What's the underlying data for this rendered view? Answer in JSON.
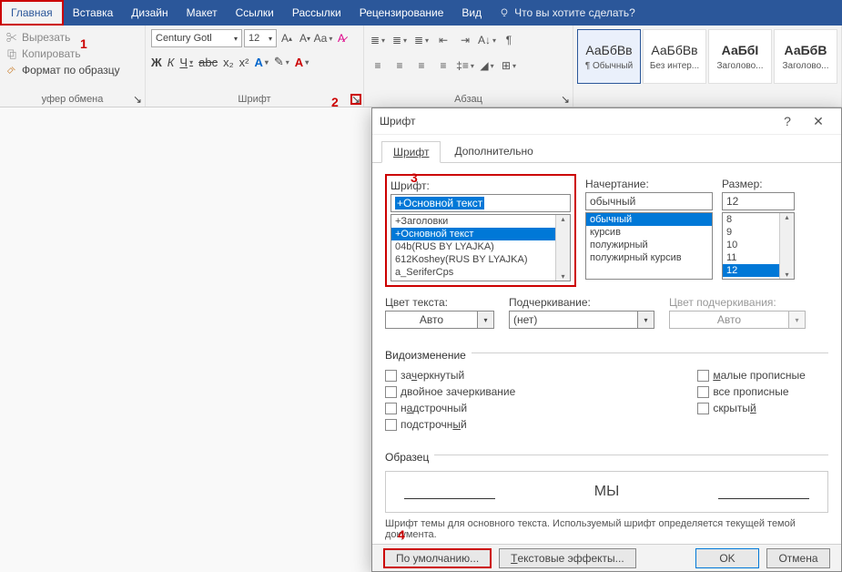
{
  "menubar": {
    "tabs": [
      "Главная",
      "Вставка",
      "Дизайн",
      "Макет",
      "Ссылки",
      "Рассылки",
      "Рецензирование",
      "Вид"
    ],
    "tell_me": "Что вы хотите сделать?"
  },
  "annotations": {
    "a1": "1",
    "a2": "2",
    "a3": "3",
    "a4": "4"
  },
  "ribbon": {
    "clipboard": {
      "cut": "Вырезать",
      "copy": "Копировать",
      "format_painter": "Формат по образцу",
      "group": "уфер обмена"
    },
    "font": {
      "name": "Century Gotl",
      "size": "12",
      "group": "Шрифт",
      "bold": "Ж",
      "italic": "К",
      "underline": "Ч",
      "strike": "abc",
      "sub": "x₂",
      "sup": "x²"
    },
    "paragraph": {
      "group": "Абзац"
    },
    "styles": {
      "preview": "АаБбВв",
      "preview_bold": "АаБбI",
      "preview_bold2": "АаБбВ",
      "s1": "¶ Обычный",
      "s2": "Без интер...",
      "s3": "Заголово...",
      "s4": "Заголово..."
    }
  },
  "dialog": {
    "title": "Шрифт",
    "tabs": {
      "font": "Шрифт",
      "advanced": "Дополнительно"
    },
    "font_label": "Шрифт:",
    "font_value": "+Основной текст",
    "font_list": [
      "+Заголовки",
      "+Основной текст",
      "04b(RUS BY LYAJKA)",
      "612Koshey(RUS BY LYAJKA)",
      "a_SeriferCps"
    ],
    "style_label": "Начертание:",
    "style_value": "обычный",
    "style_list": [
      "обычный",
      "курсив",
      "полужирный",
      "полужирный курсив"
    ],
    "size_label": "Размер:",
    "size_value": "12",
    "size_list": [
      "8",
      "9",
      "10",
      "11",
      "12"
    ],
    "color_label": "Цвет текста:",
    "color_value": "Авто",
    "underline_label": "Подчеркивание:",
    "underline_value": "(нет)",
    "ucolor_label": "Цвет подчеркивания:",
    "ucolor_value": "Авто",
    "effects_label": "Видоизменение",
    "effects": {
      "strike": "зачеркнутый",
      "dstrike": "двойное зачеркивание",
      "superscript": "надстрочный",
      "subscript": "подстрочный",
      "smallcaps": "малые прописные",
      "allcaps": "все прописные",
      "hidden": "скрытый"
    },
    "sample_label": "Образец",
    "sample_text": "МЫ",
    "hint": "Шрифт темы для основного текста. Используемый шрифт определяется текущей темой документа.",
    "default_btn": "По умолчанию...",
    "texteffects_btn": "Текстовые эффекты...",
    "ok": "OK",
    "cancel": "Отмена"
  }
}
